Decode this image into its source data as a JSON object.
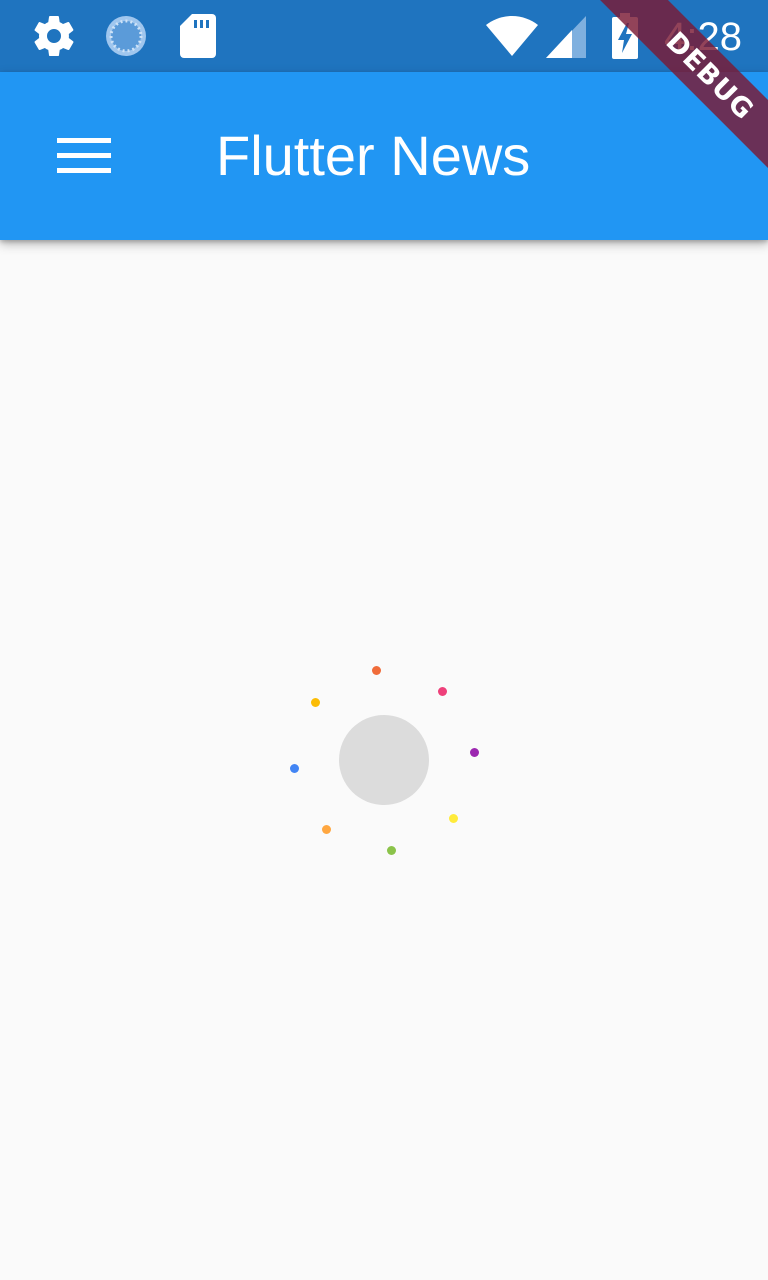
{
  "status_bar": {
    "time": "4:28",
    "left_icons": [
      "settings-icon",
      "sync-icon",
      "sd-card-icon"
    ],
    "right_icons": [
      "wifi-icon",
      "cellular-signal-icon",
      "battery-charging-icon"
    ]
  },
  "app_bar": {
    "title": "Flutter News",
    "menu_icon": "hamburger-menu-icon",
    "background_color": "#2196f3"
  },
  "debug_banner": {
    "label": "DEBUG"
  },
  "loading_indicator": {
    "center_color": "#dcdcdc",
    "dot_colors": [
      "#f06c3a",
      "#ee407a",
      "#9c27b0",
      "#ffeb3b",
      "#8bc34a",
      "#ffa740",
      "#4285f4",
      "#fbbc05"
    ]
  }
}
